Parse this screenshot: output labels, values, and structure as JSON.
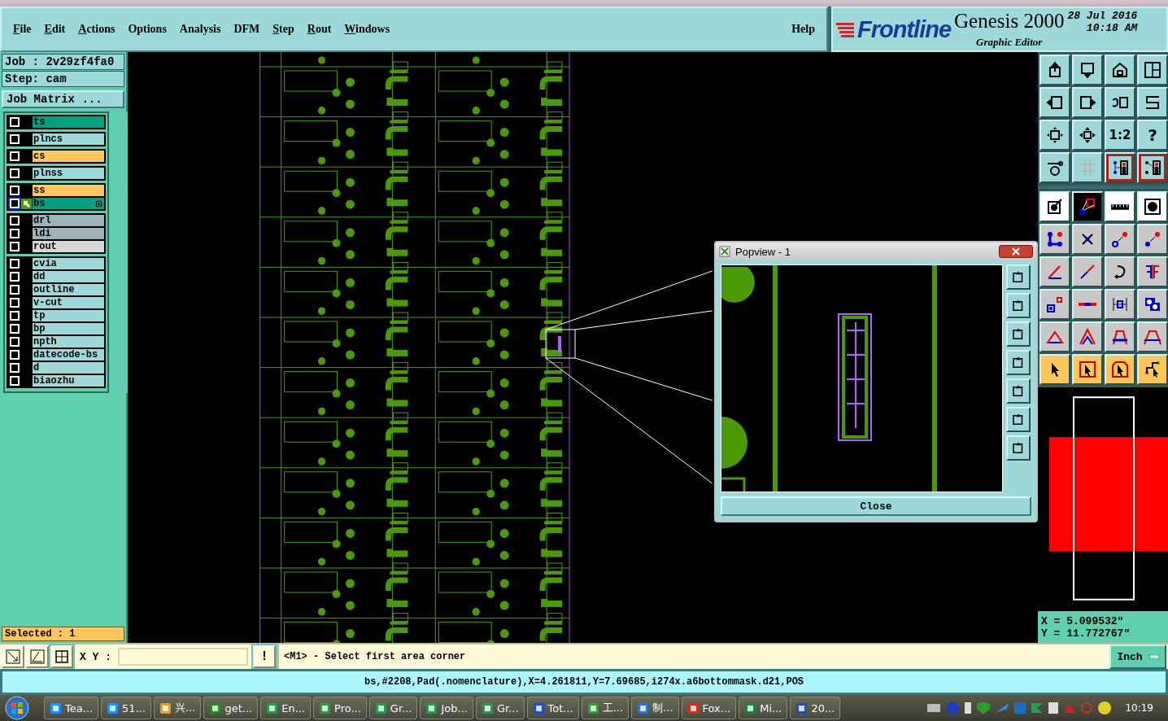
{
  "menu": [
    {
      "label": "File",
      "mnemonic": true
    },
    {
      "label": "Edit",
      "mnemonic": true
    },
    {
      "label": "Actions",
      "mnemonic": true
    },
    {
      "label": "Options",
      "mnemonic": false
    },
    {
      "label": "Analysis",
      "mnemonic": false
    },
    {
      "label": "DFM",
      "mnemonic": false
    },
    {
      "label": "Step",
      "mnemonic": true
    },
    {
      "label": "Rout",
      "mnemonic": true
    },
    {
      "label": "Windows",
      "mnemonic": true
    }
  ],
  "help_menu": {
    "label": "Help",
    "mnemonic": false
  },
  "brand": {
    "logo": "Frontline",
    "product": "Genesis 2000",
    "subtitle": "Graphic Editor",
    "date": "28 Jul 2016",
    "time": "10:18 AM"
  },
  "job": {
    "job": "Job : 2v29zf4fa0",
    "step": "Step: cam",
    "matrix_button": "Job Matrix ..."
  },
  "layer_groups": [
    [
      {
        "name": "ts",
        "color": "#00a07e",
        "checked": false,
        "selected": false
      }
    ],
    [
      {
        "name": "plncs",
        "color": "#9dd9d9",
        "checked": false,
        "selected": false
      }
    ],
    [
      {
        "name": "cs",
        "color": "#ffc65a",
        "checked": false,
        "selected": false
      }
    ],
    [
      {
        "name": "plnss",
        "color": "#9dd9d9",
        "checked": false,
        "selected": false
      }
    ],
    [
      {
        "name": "ss",
        "color": "#ffc65a",
        "checked": false,
        "selected": false
      },
      {
        "name": "bs",
        "color": "#00a07e",
        "checked": false,
        "selected": true
      }
    ],
    [
      {
        "name": "drl",
        "color": "#9fb3bc",
        "checked": false,
        "selected": false
      },
      {
        "name": "ldi",
        "color": "#9fb3bc",
        "checked": false,
        "selected": false
      },
      {
        "name": "rout",
        "color": "#d8d8d8",
        "checked": false,
        "selected": false
      }
    ],
    [
      {
        "name": "cvia",
        "color": "#9dd9d9",
        "checked": false,
        "selected": false
      },
      {
        "name": "dd",
        "color": "#9dd9d9",
        "checked": false,
        "selected": false
      },
      {
        "name": "outline",
        "color": "#9dd9d9",
        "checked": false,
        "selected": false
      },
      {
        "name": "v-cut",
        "color": "#9dd9d9",
        "checked": false,
        "selected": false
      },
      {
        "name": "tp",
        "color": "#9dd9d9",
        "checked": false,
        "selected": false
      },
      {
        "name": "bp",
        "color": "#9dd9d9",
        "checked": false,
        "selected": false
      },
      {
        "name": "npth",
        "color": "#9dd9d9",
        "checked": false,
        "selected": false
      },
      {
        "name": "datecode-bs",
        "color": "#9dd9d9",
        "checked": false,
        "selected": false
      },
      {
        "name": "d",
        "color": "#9dd9d9",
        "checked": false,
        "selected": false
      },
      {
        "name": "biaozhu",
        "color": "#9dd9d9",
        "checked": false,
        "selected": false
      }
    ]
  ],
  "selected_count": "Selected : 1",
  "toolbar": {
    "ratio": "1:2",
    "help": "?"
  },
  "popview": {
    "title": "Popview - 1",
    "close_button": "Close"
  },
  "coordinates": {
    "x": "X = 5.099532\"",
    "y": "Y = 11.772767\""
  },
  "units_button": "Inch",
  "command": {
    "xy_label": "X Y :",
    "confirm": "!",
    "prompt": "<M1> - Select first area corner"
  },
  "status": "bs,#2208,Pad(.nomenclature),X=4.261811,Y=7.69685,i274x.a6bottommask.d21,POS",
  "taskbar": {
    "items": [
      "Tea...",
      "51...",
      "兴...",
      "get...",
      "En...",
      "Pro...",
      "Gr...",
      "Job...",
      "Gr...",
      "Tot...",
      "工...",
      "制...",
      "Fox...",
      "Mi...",
      "20..."
    ],
    "clock": "10:19"
  }
}
